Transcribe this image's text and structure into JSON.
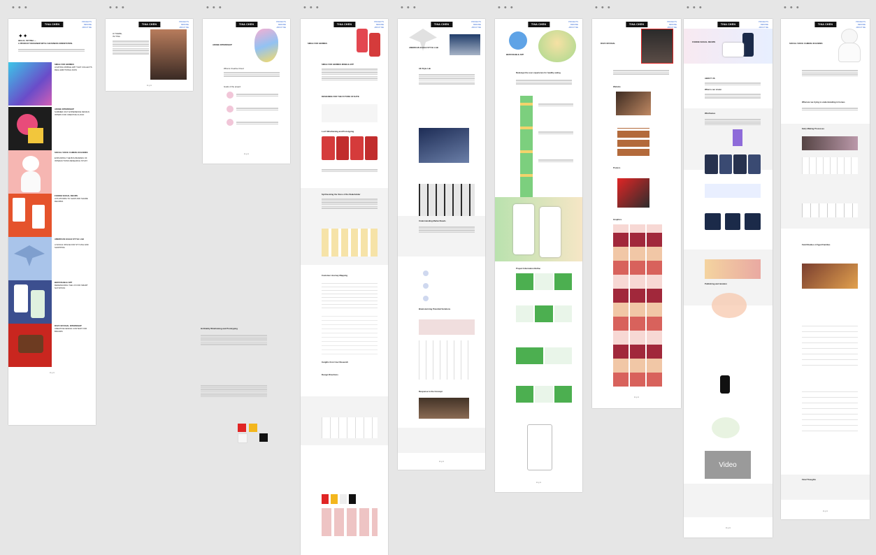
{
  "canvas": {
    "bg": "#e6e6e6"
  },
  "logo_text": "TINA CHEN",
  "nav": [
    "PROJECTS",
    "RESUME",
    "ABOUT ME"
  ],
  "artboards": {
    "home": {
      "intro_title": "HELLO, I'M TINA —",
      "intro_subtitle": "A PRODUCT DESIGNER WITH A BUSINESS ORIENTATION.",
      "projects": [
        {
          "title": "SMILE FOR HERMES",
          "desc": "A DATING MOBILE APP THAT COLLECTS REAL EMOTIONAL DATA"
        },
        {
          "title": "ADOBE INTERNSHIP",
          "desc": "SUMMER 2017 EXPERIENCE DESIGN INTERN FOR CREATIVE CLOUD"
        },
        {
          "title": "SOCIAL VOICE CAMERA IN HOMES",
          "desc": "EXPLORING THE BOUNDARIES OF INTERACTIONS RESEARCH STUDY"
        },
        {
          "title": "FOODIE SOCIAL RECIPE",
          "desc": "A PLATFORM TO SHOP AND SHARE RECIPES"
        },
        {
          "title": "AMERICAN EAGLE STYLE LAB",
          "desc": "A SOCIAL SPACE FOR STYLING AND SHOPPING"
        },
        {
          "title": "BEFR DIABLE APP",
          "desc": "REDESIGNING THE UX FOR SMART NUTRITION"
        },
        {
          "title": "RUZZ OFFICIAL INTERNSHIP",
          "desc": "CREATIVE DESIGN CONTENT FOR BRANDS"
        }
      ]
    },
    "about": {
      "heading": "HI THERE,",
      "subheading": "I'M TINA"
    },
    "adobe": {
      "heading": "ADOBE INTERNSHIP",
      "section1": "What is Creative Cloud",
      "section2": "Goals of the project"
    },
    "hermes": {
      "heading": "SMILE FOR HERMES",
      "subtitle": "SMILE FOR HERMES MOBILE APP",
      "section": "DESIGNING FOR THE FUTURE OF DATE",
      "wire_title": "Hi-Fidelity Wireframing and Prototyping",
      "section2": "Synthesizing the Voice of the Stakeholder",
      "section3": "Customer Journey Mapping",
      "section4": "Insights from User Research",
      "section5": "Design Directions",
      "section6": "Lo-Fi Wireframing and Prototyping"
    },
    "eagle": {
      "heading": "AMERICAN EAGLE STYLE LAB",
      "section": "AE Style Lab",
      "section2": "Understanding Market Needs",
      "section3": "Brainstorming Potential Solutions",
      "section4": "Response to the Concept"
    },
    "befr": {
      "heading": "BEFR DIABLE APP",
      "section": "Redesign the user experience for healthy eating",
      "section2": "Project Information Refine"
    },
    "ruzz": {
      "heading": "RUZZ OFFICIAL",
      "section": "Website",
      "section2": "Posters",
      "section3": "Graphics"
    },
    "foodie": {
      "heading": "FOODIE SOCIAL RECIPE",
      "section": "ABOUT US",
      "section2": "What is our vision",
      "section3": "Wireframes",
      "section4": "Publishing and iteration",
      "video_label": "Video"
    },
    "voice": {
      "heading": "SOCIAL VOICE CAMERA IN HOMES",
      "section": "What are we trying to understanding in homes",
      "section2": "Early Making Processes",
      "section3": "Field Studies of Aged Families",
      "section4": "Final Thoughts"
    }
  }
}
